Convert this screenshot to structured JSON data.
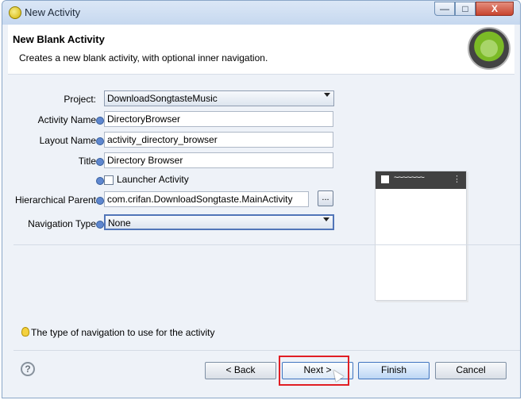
{
  "window": {
    "title": "New Activity"
  },
  "header": {
    "title": "New Blank Activity",
    "description": "Creates a new blank activity, with optional inner navigation."
  },
  "form": {
    "project": {
      "label": "Project:",
      "value": "DownloadSongtasteMusic"
    },
    "activity_name": {
      "label": "Activity Name",
      "value": "DirectoryBrowser"
    },
    "layout_name": {
      "label": "Layout Name",
      "value": "activity_directory_browser"
    },
    "title": {
      "label": "Title",
      "value": "Directory Browser"
    },
    "launcher_activity": {
      "label": "Launcher Activity",
      "checked": false
    },
    "hierarchical_parent": {
      "label": "Hierarchical Parent",
      "value": "com.crifan.DownloadSongtaste.MainActivity",
      "browse_label": "..."
    },
    "navigation_type": {
      "label": "Navigation Type",
      "value": "None"
    }
  },
  "hint": {
    "text": "The type of navigation to use for the activity"
  },
  "buttons": {
    "help": "?",
    "back": "< Back",
    "next": "Next >",
    "finish": "Finish",
    "cancel": "Cancel"
  },
  "preview": {
    "title": "~~~~~~~",
    "menu": "⋮"
  },
  "icons": {
    "window": "android-wizard-icon",
    "info": "info-dot-icon",
    "hint": "lightbulb-icon",
    "help": "help-icon"
  }
}
